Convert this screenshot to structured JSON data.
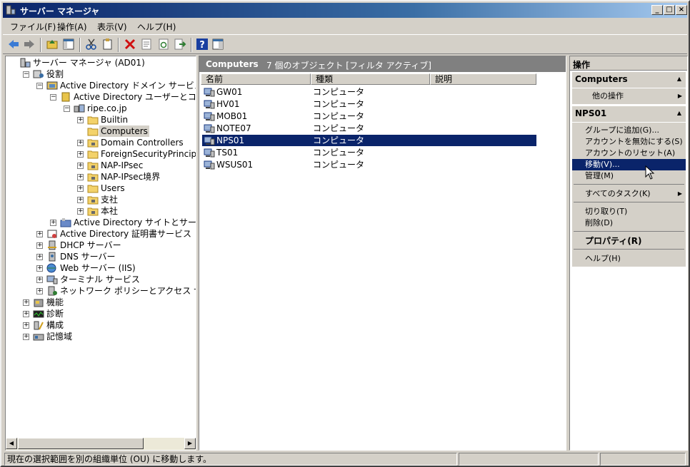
{
  "window": {
    "title": "サーバー マネージャ",
    "colors": {
      "title_active": "#0a246a",
      "selection": "#0a246a",
      "face": "#d4d0c8"
    }
  },
  "menu": [
    "ファイル(F)",
    "操作(A)",
    "表示(V)",
    "ヘルプ(H)"
  ],
  "toolbar": [
    "back-icon",
    "forward-icon",
    "up-folder-icon",
    "console-tree-icon",
    "cut-icon",
    "copy-icon",
    "delete-icon",
    "properties-icon",
    "refresh-icon",
    "export-icon",
    "help-icon",
    "show-pane-icon"
  ],
  "tree": {
    "root": "サーバー マネージャ (AD01)",
    "roles": "役割",
    "adds": "Active Directory ドメイン サービス",
    "aduc": "Active Directory ユーザーとコンピュータ",
    "domain": "ripe.co.jp",
    "ous": [
      "Builtin",
      "Computers",
      "Domain Controllers",
      "ForeignSecurityPrincipals",
      "NAP-IPsec",
      "NAP-IPsec境界",
      "Users",
      "支社",
      "本社"
    ],
    "adss": "Active Directory サイトとサービス",
    "adcs": "Active Directory 証明書サービス",
    "dhcp": "DHCP サーバー",
    "dns": "DNS サーバー",
    "web": "Web サーバー (IIS)",
    "ts": "ターミナル サービス",
    "nps": "ネットワーク ポリシーとアクセス サービス",
    "features": "機能",
    "diagnostics": "診断",
    "configuration": "構成",
    "storage": "記憶域"
  },
  "list": {
    "title": "Computers",
    "subtitle": "7 個のオブジェクト [フィルタ アクティブ]",
    "columns": [
      "名前",
      "種類",
      "説明"
    ],
    "rows": [
      {
        "name": "GW01",
        "type": "コンピュータ"
      },
      {
        "name": "HV01",
        "type": "コンピュータ"
      },
      {
        "name": "MOB01",
        "type": "コンピュータ"
      },
      {
        "name": "NOTE07",
        "type": "コンピュータ"
      },
      {
        "name": "NPS01",
        "type": "コンピュータ"
      },
      {
        "name": "TS01",
        "type": "コンピュータ"
      },
      {
        "name": "WSUS01",
        "type": "コンピュータ"
      }
    ]
  },
  "actions": {
    "title": "操作",
    "section1": "Computers",
    "section1_items": [
      "他の操作"
    ],
    "section2": "NPS01",
    "section2_items": [
      "グループに追加(G)...",
      "アカウントを無効にする(S)",
      "アカウントのリセット(A)",
      "移動(V)...",
      "管理(M)",
      "すべてのタスク(K)",
      "切り取り(T)",
      "削除(D)",
      "プロパティ(R)",
      "ヘルプ(H)"
    ]
  },
  "status": {
    "text": "現在の選択範囲を別の組織単位 (OU) に移動します。"
  }
}
